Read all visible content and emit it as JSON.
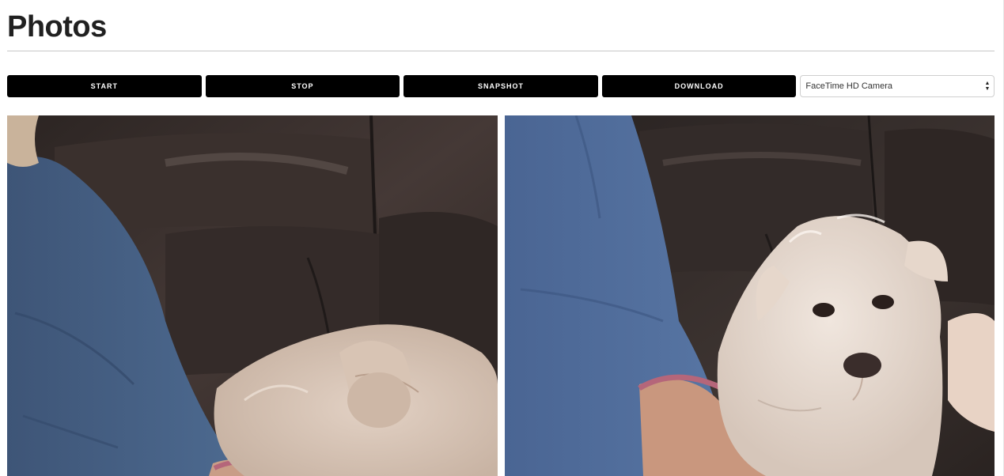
{
  "page": {
    "title": "Photos"
  },
  "toolbar": {
    "start_label": "START",
    "stop_label": "STOP",
    "snapshot_label": "SNAPSHOT",
    "download_label": "DOWNLOAD"
  },
  "camera_select": {
    "selected": "FaceTime HD Camera",
    "icon": "select-arrows-icon"
  },
  "photos": {
    "live_view_alt": "Live camera feed",
    "snapshot_alt": "Snapshot"
  },
  "colors": {
    "button_bg": "#000000",
    "button_text": "#ffffff",
    "title": "#202020",
    "rule": "#c8c8c8"
  }
}
